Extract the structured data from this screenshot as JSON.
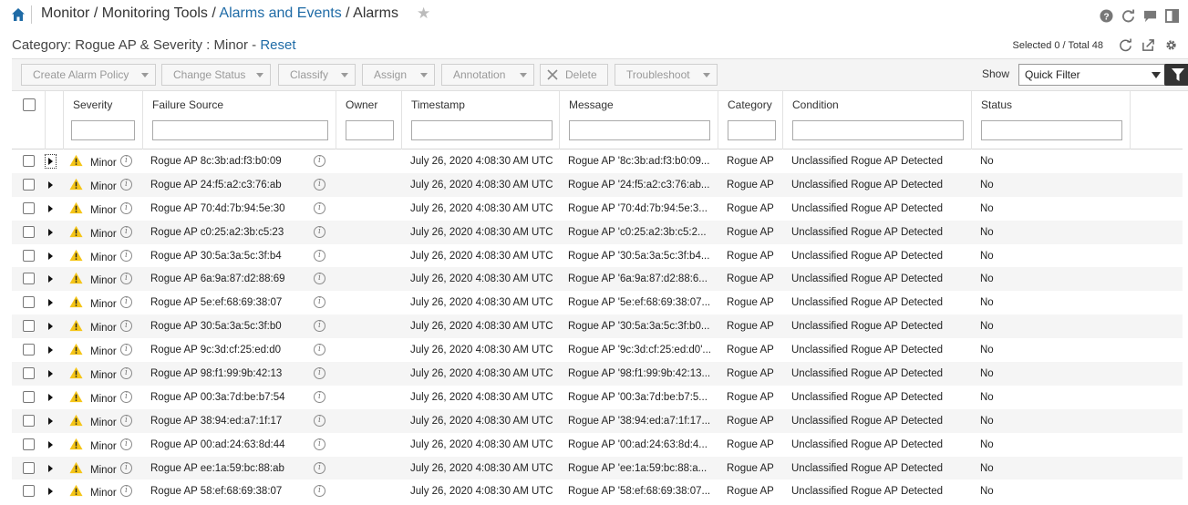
{
  "breadcrumb": {
    "items": [
      "Monitor",
      "Monitoring Tools",
      "Alarms and Events",
      "Alarms"
    ],
    "separator": "/"
  },
  "category_line": {
    "text": "Category: Rogue AP & Severity : Minor - ",
    "reset_label": "Reset"
  },
  "selection": {
    "text": "Selected 0 / Total 48"
  },
  "toolbar": {
    "buttons": [
      "Create Alarm Policy",
      "Change Status",
      "Classify",
      "Assign",
      "Annotation",
      "Delete",
      "Troubleshoot"
    ],
    "show_label": "Show",
    "quick_filter_value": "Quick Filter"
  },
  "columns": [
    "Severity",
    "Failure Source",
    "Owner",
    "Timestamp",
    "Message",
    "Category",
    "Condition",
    "Status"
  ],
  "colors": {
    "link": "#1f6ba6",
    "warning": "#f5c518",
    "header_dark": "#333333"
  },
  "rows": [
    {
      "severity": "Minor",
      "source": "Rogue AP 8c:3b:ad:f3:b0:09",
      "owner": "",
      "timestamp": "July 26, 2020 4:08:30 AM UTC",
      "message": "Rogue AP '8c:3b:ad:f3:b0:09...",
      "category": "Rogue AP",
      "condition": "Unclassified Rogue AP Detected",
      "status": "No"
    },
    {
      "severity": "Minor",
      "source": "Rogue AP 24:f5:a2:c3:76:ab",
      "owner": "",
      "timestamp": "July 26, 2020 4:08:30 AM UTC",
      "message": "Rogue AP '24:f5:a2:c3:76:ab...",
      "category": "Rogue AP",
      "condition": "Unclassified Rogue AP Detected",
      "status": "No"
    },
    {
      "severity": "Minor",
      "source": "Rogue AP 70:4d:7b:94:5e:30",
      "owner": "",
      "timestamp": "July 26, 2020 4:08:30 AM UTC",
      "message": "Rogue AP '70:4d:7b:94:5e:3...",
      "category": "Rogue AP",
      "condition": "Unclassified Rogue AP Detected",
      "status": "No"
    },
    {
      "severity": "Minor",
      "source": "Rogue AP c0:25:a2:3b:c5:23",
      "owner": "",
      "timestamp": "July 26, 2020 4:08:30 AM UTC",
      "message": "Rogue AP 'c0:25:a2:3b:c5:2...",
      "category": "Rogue AP",
      "condition": "Unclassified Rogue AP Detected",
      "status": "No"
    },
    {
      "severity": "Minor",
      "source": "Rogue AP 30:5a:3a:5c:3f:b4",
      "owner": "",
      "timestamp": "July 26, 2020 4:08:30 AM UTC",
      "message": "Rogue AP '30:5a:3a:5c:3f:b4...",
      "category": "Rogue AP",
      "condition": "Unclassified Rogue AP Detected",
      "status": "No"
    },
    {
      "severity": "Minor",
      "source": "Rogue AP 6a:9a:87:d2:88:69",
      "owner": "",
      "timestamp": "July 26, 2020 4:08:30 AM UTC",
      "message": "Rogue AP '6a:9a:87:d2:88:6...",
      "category": "Rogue AP",
      "condition": "Unclassified Rogue AP Detected",
      "status": "No"
    },
    {
      "severity": "Minor",
      "source": "Rogue AP 5e:ef:68:69:38:07",
      "owner": "",
      "timestamp": "July 26, 2020 4:08:30 AM UTC",
      "message": "Rogue AP '5e:ef:68:69:38:07...",
      "category": "Rogue AP",
      "condition": "Unclassified Rogue AP Detected",
      "status": "No"
    },
    {
      "severity": "Minor",
      "source": "Rogue AP 30:5a:3a:5c:3f:b0",
      "owner": "",
      "timestamp": "July 26, 2020 4:08:30 AM UTC",
      "message": "Rogue AP '30:5a:3a:5c:3f:b0...",
      "category": "Rogue AP",
      "condition": "Unclassified Rogue AP Detected",
      "status": "No"
    },
    {
      "severity": "Minor",
      "source": "Rogue AP 9c:3d:cf:25:ed:d0",
      "owner": "",
      "timestamp": "July 26, 2020 4:08:30 AM UTC",
      "message": "Rogue AP '9c:3d:cf:25:ed:d0'...",
      "category": "Rogue AP",
      "condition": "Unclassified Rogue AP Detected",
      "status": "No"
    },
    {
      "severity": "Minor",
      "source": "Rogue AP 98:f1:99:9b:42:13",
      "owner": "",
      "timestamp": "July 26, 2020 4:08:30 AM UTC",
      "message": "Rogue AP '98:f1:99:9b:42:13...",
      "category": "Rogue AP",
      "condition": "Unclassified Rogue AP Detected",
      "status": "No"
    },
    {
      "severity": "Minor",
      "source": "Rogue AP 00:3a:7d:be:b7:54",
      "owner": "",
      "timestamp": "July 26, 2020 4:08:30 AM UTC",
      "message": "Rogue AP '00:3a:7d:be:b7:5...",
      "category": "Rogue AP",
      "condition": "Unclassified Rogue AP Detected",
      "status": "No"
    },
    {
      "severity": "Minor",
      "source": "Rogue AP 38:94:ed:a7:1f:17",
      "owner": "",
      "timestamp": "July 26, 2020 4:08:30 AM UTC",
      "message": "Rogue AP '38:94:ed:a7:1f:17...",
      "category": "Rogue AP",
      "condition": "Unclassified Rogue AP Detected",
      "status": "No"
    },
    {
      "severity": "Minor",
      "source": "Rogue AP 00:ad:24:63:8d:44",
      "owner": "",
      "timestamp": "July 26, 2020 4:08:30 AM UTC",
      "message": "Rogue AP '00:ad:24:63:8d:4...",
      "category": "Rogue AP",
      "condition": "Unclassified Rogue AP Detected",
      "status": "No"
    },
    {
      "severity": "Minor",
      "source": "Rogue AP ee:1a:59:bc:88:ab",
      "owner": "",
      "timestamp": "July 26, 2020 4:08:30 AM UTC",
      "message": "Rogue AP 'ee:1a:59:bc:88:a...",
      "category": "Rogue AP",
      "condition": "Unclassified Rogue AP Detected",
      "status": "No"
    },
    {
      "severity": "Minor",
      "source": "Rogue AP 58:ef:68:69:38:07",
      "owner": "",
      "timestamp": "July 26, 2020 4:08:30 AM UTC",
      "message": "Rogue AP '58:ef:68:69:38:07...",
      "category": "Rogue AP",
      "condition": "Unclassified Rogue AP Detected",
      "status": "No"
    }
  ]
}
